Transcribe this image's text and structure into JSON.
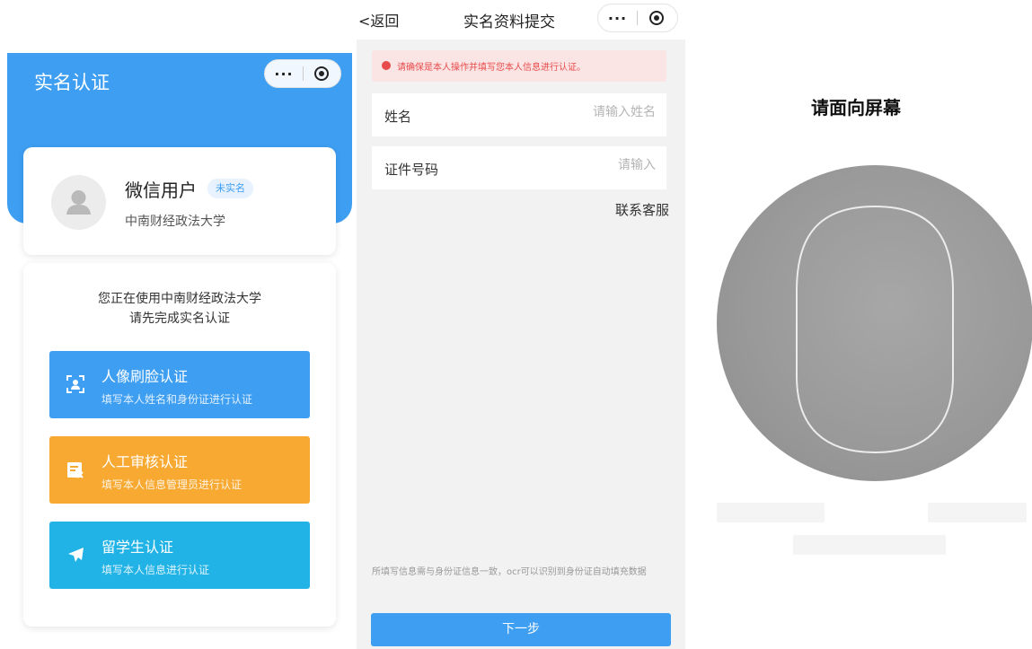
{
  "capsule": {
    "dots": "···"
  },
  "panel1": {
    "title": "实名认证",
    "user": {
      "name": "微信用户",
      "badge": "未实名",
      "school": "中南财经政法大学"
    },
    "intro": {
      "line1": "您正在使用中南财经政法大学",
      "line2": "请先完成实名认证"
    },
    "methods": [
      {
        "title": "人像刷脸认证",
        "desc": "填写本人姓名和身份证进行认证",
        "color": "#3d9ef2",
        "icon": "face-scan-icon"
      },
      {
        "title": "人工审核认证",
        "desc": "填写本人信息管理员进行认证",
        "color": "#f7a932",
        "icon": "id-card-icon"
      },
      {
        "title": "留学生认证",
        "desc": "填写本人信息进行认证",
        "color": "#21b3e6",
        "icon": "airplane-icon"
      }
    ]
  },
  "panel2": {
    "back": "<返回",
    "title": "实名资料提交",
    "warning": "请确保是本人操作并填写您本人信息进行认证。",
    "fields": [
      {
        "label": "姓名",
        "placeholder": "请输入姓名"
      },
      {
        "label": "证件号码",
        "placeholder": "请输入"
      }
    ],
    "contact": "联系客服",
    "note": "所填写信息需与身份证信息一致，ocr可以识别到身份证自动填充数据",
    "next": "下一步"
  },
  "panel3": {
    "title": "请面向屏幕"
  }
}
